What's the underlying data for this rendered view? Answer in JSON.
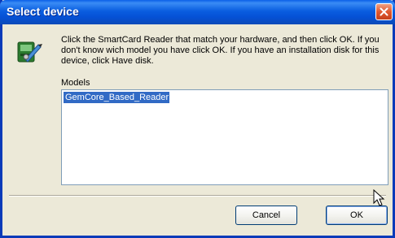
{
  "window": {
    "title": "Select device"
  },
  "dialog": {
    "instructions": "Click the SmartCard Reader that match your hardware, and then click OK. If you don't know wich model you have click OK. If you have an installation disk for this device, click Have disk.",
    "models_label": "Models",
    "models": [
      {
        "label": "GemCore_Based_Reader",
        "selected": true
      }
    ]
  },
  "buttons": {
    "cancel_label": "Cancel",
    "ok_label": "OK"
  },
  "icons": {
    "title_close": "close-icon",
    "device": "hardware-install-icon",
    "cursor": "mouse-pointer-icon"
  },
  "colors": {
    "titlebar": "#0a5fe8",
    "dialog_background": "#ece9d8",
    "selection": "#316ac5",
    "close_button": "#e1582f"
  }
}
